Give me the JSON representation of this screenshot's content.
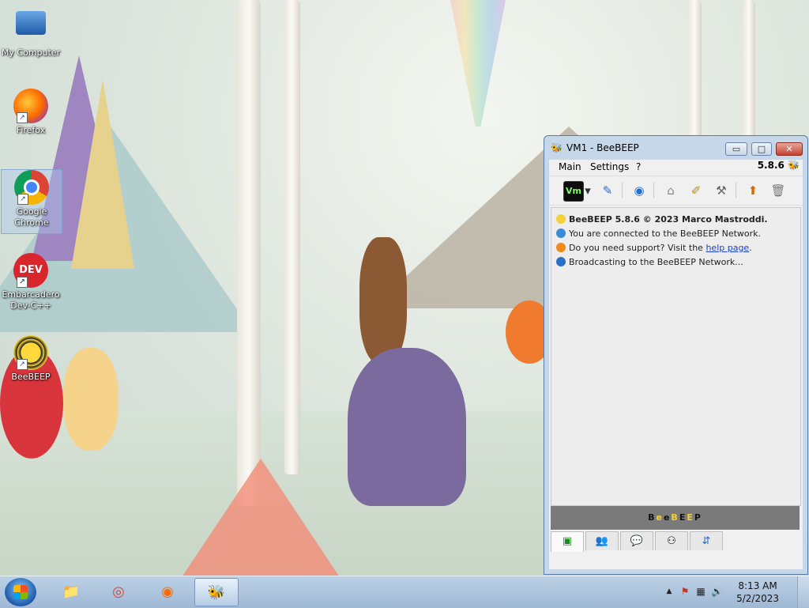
{
  "desktop": {
    "icons": [
      {
        "label": "My Computer",
        "icon": "computer-icon"
      },
      {
        "label": "Firefox",
        "icon": "firefox-icon"
      },
      {
        "label": "Google Chrome",
        "icon": "chrome-icon"
      },
      {
        "label": "Embarcadero Dev-C++",
        "icon": "devcpp-icon",
        "glyph": "DEV"
      },
      {
        "label": "BeeBEEP",
        "icon": "beebeep-icon"
      }
    ]
  },
  "window": {
    "title": "VM1 - BeeBEEP",
    "controls": {
      "minimize": "▭",
      "maximize": "□",
      "close": "✕"
    },
    "menu": [
      "Main",
      "Settings",
      "?"
    ],
    "version": "5.8.6",
    "toolbar": [
      {
        "name": "status-vm-icon",
        "glyph": "Vm"
      },
      {
        "name": "status-dropdown-icon",
        "glyph": "▾"
      },
      {
        "name": "edit-profile-icon",
        "glyph": "✎"
      },
      {
        "name": "network-icon",
        "glyph": "◉"
      },
      {
        "name": "home-icon",
        "glyph": "⌂"
      },
      {
        "name": "note-icon",
        "glyph": "✐"
      },
      {
        "name": "tools-icon",
        "glyph": "⚒"
      },
      {
        "name": "update-icon",
        "glyph": "⬆"
      },
      {
        "name": "trash-icon",
        "glyph": "🗑"
      }
    ],
    "log": {
      "line1": "BeeBEEP 5.8.6 © 2023 Marco Mastroddi.",
      "line2": "You are connected to the BeeBEEP Network.",
      "line3_pre": "Do you need support? Visit the ",
      "line3_link": "help page",
      "line3_post": ".",
      "line4": "Broadcasting to the BeeBEEP Network..."
    },
    "brand": [
      "B",
      "e",
      "e",
      "B",
      "E",
      "E",
      "P"
    ],
    "tabs": [
      {
        "name": "tab-home",
        "glyph": "▣"
      },
      {
        "name": "tab-users",
        "glyph": "👥"
      },
      {
        "name": "tab-chats",
        "glyph": "💬"
      },
      {
        "name": "tab-groups",
        "glyph": "⚇"
      },
      {
        "name": "tab-files",
        "glyph": "⇵"
      }
    ]
  },
  "taskbar": {
    "apps": [
      {
        "name": "explorer",
        "glyph": "📁"
      },
      {
        "name": "chrome",
        "glyph": "◎"
      },
      {
        "name": "firefox",
        "glyph": "◉"
      },
      {
        "name": "beebeep",
        "glyph": "🐝"
      }
    ],
    "tray": {
      "up": "▲",
      "flag": "⚑",
      "network": "▦",
      "volume": "🔊"
    },
    "time": "8:13 AM",
    "date": "5/2/2023"
  },
  "colors": {
    "accent": "#1a3fc8",
    "brand_bar": "#7a7a7a",
    "brand_yellow": "#f4d23c"
  }
}
